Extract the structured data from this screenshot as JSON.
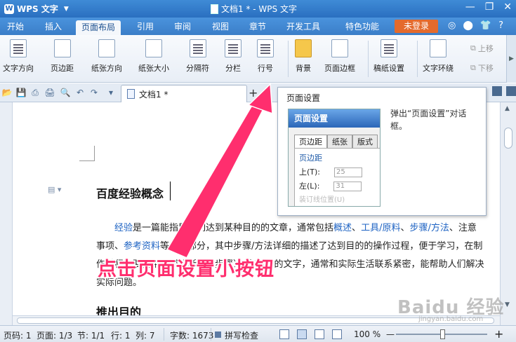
{
  "window": {
    "app_name": "WPS 文字",
    "title": "文档1 * - WPS 文字",
    "controls": [
      "—",
      "❐",
      "✕"
    ]
  },
  "menu": {
    "tabs": [
      "开始",
      "插入",
      "页面布局",
      "引用",
      "审阅",
      "视图",
      "章节",
      "开发工具",
      "特色功能"
    ],
    "active": "页面布局",
    "login": "未登录",
    "right_icons": [
      "◎",
      "⬤",
      "👕",
      "?"
    ]
  },
  "ribbon": {
    "buttons": [
      "文字方向",
      "页边距",
      "纸张方向",
      "纸张大小",
      "分隔符",
      "分栏",
      "行号",
      "背景",
      "页面边框",
      "稿纸设置",
      "文字环绕"
    ],
    "small_buttons": [
      "上移",
      "下移"
    ],
    "launcher_glyph": "⧉"
  },
  "quickbar": {
    "doc_tab": "文档1 *",
    "new_tab": "+",
    "icons": [
      "📂",
      "💾",
      "⎙",
      "🖨",
      "🔍",
      "↶",
      "↷",
      "▾"
    ]
  },
  "document": {
    "heading": "百度经验概念",
    "para1": {
      "a": "经验",
      "b": "是一篇能指导人们达到某种目的的文章，通常包括",
      "c": "概述",
      "d": "、",
      "e": "工具/原料",
      "f": "、",
      "g": "步骤/方法",
      "h": "、注意事项、",
      "i": "参考资料",
      "j": "等几个部分，其中步骤/方法详细的描述了达到目的的操作过程，便于学习，在制作过程中要使用逻辑清晰（有步骤）、和简明的文字，通常和实际生活联系紧密，能帮助人们解决实际问题。"
    },
    "heading2": "推出目的"
  },
  "tooltip": {
    "title": "页面设置",
    "description": "弹出“页面设置”对话框。",
    "preview": {
      "dialog_title": "页面设置",
      "tabs": [
        "页边距",
        "纸张",
        "版式"
      ],
      "group": "页边距",
      "rows": [
        {
          "label": "上(T):",
          "value": "25"
        },
        {
          "label": "左(L):",
          "value": "31"
        }
      ],
      "extra": "装订线位置(U)"
    }
  },
  "annotation": "点击页面设置小按钮",
  "watermark": {
    "main": "Baidu 经验",
    "sub": "jingyan.baidu.com"
  },
  "statusbar": {
    "page_code": "页码: 1",
    "page": "页面: 1/3",
    "section": "节: 1/1",
    "row": "行: 1",
    "col": "列: 7",
    "words": "字数: 1673",
    "spell": "拼写检查",
    "zoom": "100 %",
    "zoom_minus": "—",
    "zoom_plus": "+"
  },
  "colors": {
    "title_bar": "#2a6fc0",
    "login_button": "#e46a2c",
    "annotation": "#ff2e6e",
    "link": "#1e63c3"
  }
}
